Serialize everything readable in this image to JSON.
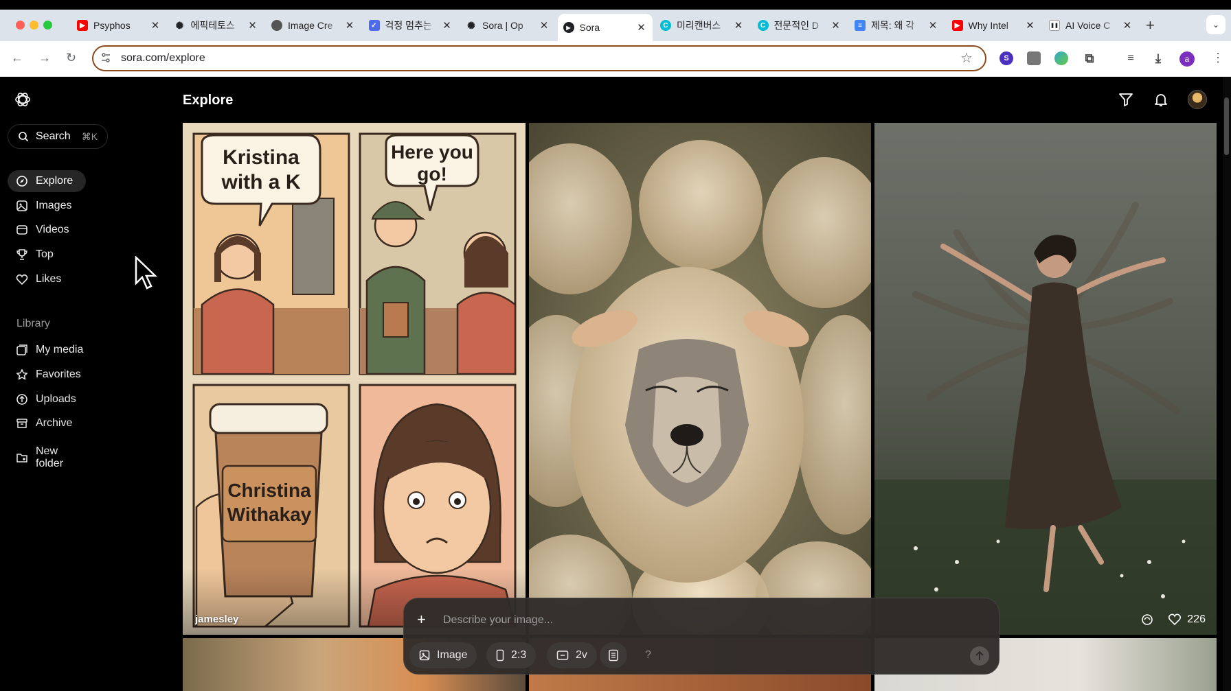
{
  "browser": {
    "tabs": [
      {
        "label": "Psyphos",
        "icon": "youtube-icon",
        "color": "#ff0000"
      },
      {
        "label": "에픽테토스",
        "icon": "openai-icon",
        "color": "#202124"
      },
      {
        "label": "Image Cre",
        "icon": "globe-icon",
        "color": "#555555"
      },
      {
        "label": "걱정 멈추는",
        "icon": "shield-icon",
        "color": "#4f6bed"
      },
      {
        "label": "Sora | Op",
        "icon": "openai-icon",
        "color": "#202124"
      },
      {
        "label": "Sora",
        "icon": "play-circle-icon",
        "color": "#202124",
        "active": true
      },
      {
        "label": "미리캔버스",
        "icon": "canva-icon",
        "color": "#00bcd4"
      },
      {
        "label": "전문적인 D",
        "icon": "canva-icon",
        "color": "#00bcd4"
      },
      {
        "label": "제목: 왜 각",
        "icon": "docs-icon",
        "color": "#4285f4"
      },
      {
        "label": "Why Intel",
        "icon": "youtube-icon",
        "color": "#ff0000"
      },
      {
        "label": "AI Voice C",
        "icon": "pause-icon",
        "color": "#202124"
      }
    ],
    "url": "sora.com/explore",
    "profile_initial": "a"
  },
  "sidebar": {
    "search_label": "Search",
    "search_shortcut": "⌘K",
    "nav": [
      {
        "label": "Explore",
        "icon": "compass-icon",
        "active": true
      },
      {
        "label": "Images",
        "icon": "image-icon"
      },
      {
        "label": "Videos",
        "icon": "video-icon"
      },
      {
        "label": "Top",
        "icon": "trophy-icon"
      },
      {
        "label": "Likes",
        "icon": "heart-icon"
      }
    ],
    "library_heading": "Library",
    "library": [
      {
        "label": "My media",
        "icon": "media-icon"
      },
      {
        "label": "Favorites",
        "icon": "star-icon"
      },
      {
        "label": "Uploads",
        "icon": "upload-icon"
      },
      {
        "label": "Archive",
        "icon": "archive-icon"
      }
    ],
    "new_folder": "New folder"
  },
  "header": {
    "title": "Explore"
  },
  "feed": {
    "cards": [
      {
        "user": "jamesley",
        "comic": {
          "p1": "Kristina\nwith a K",
          "p2": "Here you\ngo!",
          "cup": "Christina\nWithakay"
        }
      },
      {
        "user": ""
      },
      {
        "user": "",
        "likes": "226"
      }
    ]
  },
  "composer": {
    "placeholder": "Describe your image...",
    "type_label": "Image",
    "ratio_label": "2:3",
    "variations_label": "2v",
    "help_label": "?"
  }
}
